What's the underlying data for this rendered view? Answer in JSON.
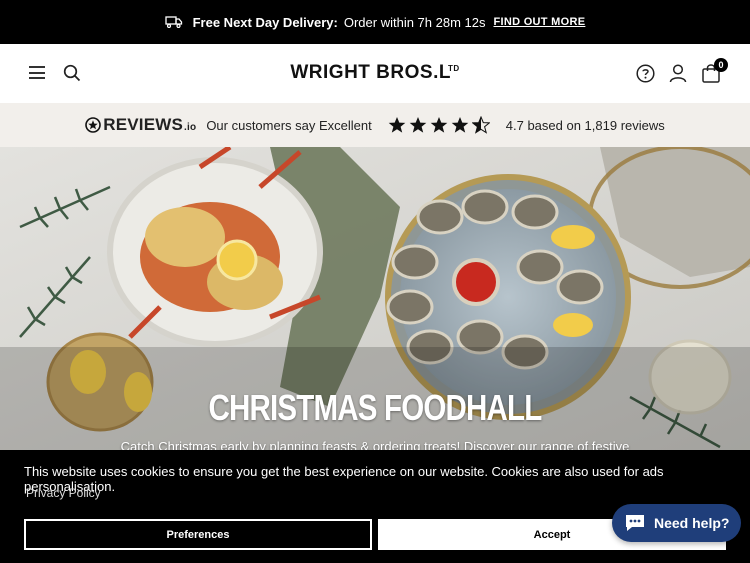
{
  "announcement": {
    "bold": "Free Next Day Delivery:",
    "text": "Order within 7h 28m 12s",
    "link": "FIND OUT MORE"
  },
  "header": {
    "logo": "WRIGHT BROS.L",
    "logo_sup": "TD",
    "cart_count": "0"
  },
  "reviews": {
    "brand": "REVIEWS",
    "brand_suffix": ".io",
    "tagline": "Our customers say Excellent",
    "rating_text": "4.7 based on 1,819 reviews",
    "rating": 4.7
  },
  "hero": {
    "title": "CHRISTMAS FOODHALL",
    "subtitle": "Catch Christmas early by planning feasts & ordering treats! Discover our range of festive"
  },
  "cookie": {
    "message": "This website uses cookies to ensure you get the best experience on our website. Cookies are also used for ads personalisation.",
    "policy_link": "Privacy Policy",
    "preferences_label": "Preferences",
    "accept_label": "Accept"
  },
  "chat": {
    "label": "Need help?"
  },
  "colors": {
    "topbar": "#000000",
    "reviews_bg": "#f2efeb",
    "chat": "#1f3e7a"
  }
}
